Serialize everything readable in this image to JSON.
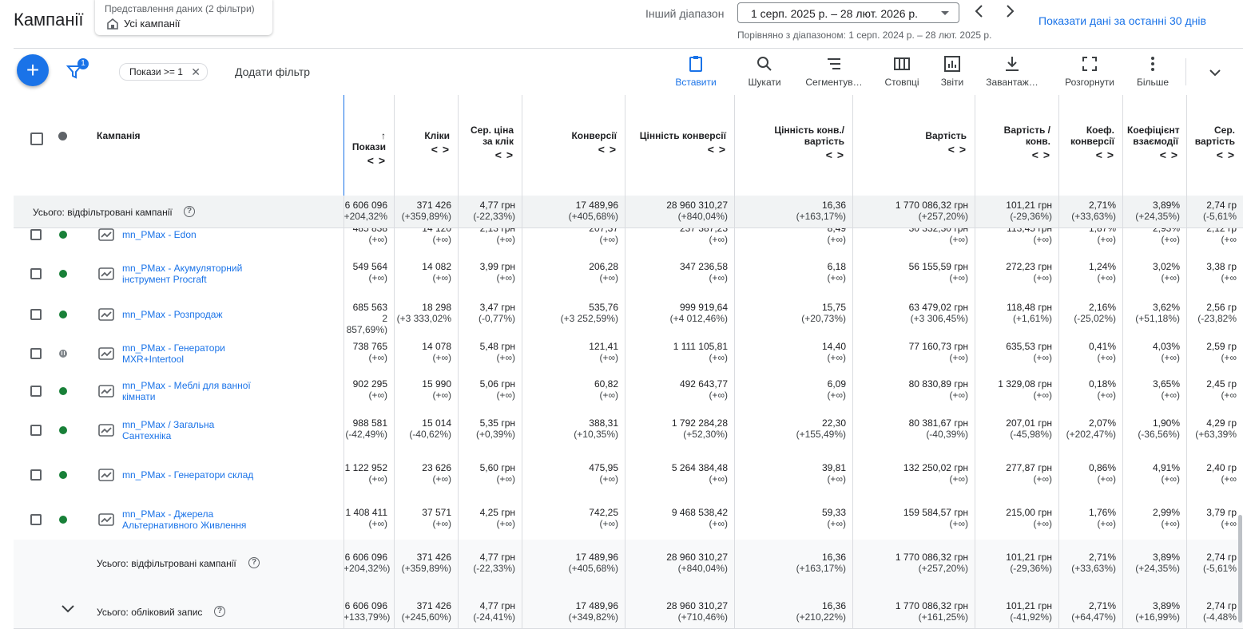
{
  "header": {
    "title": "Кампанії",
    "view_label": "Представлення даних (2 фільтри)",
    "view_value": "Усі кампанії",
    "range_label": "Інший діапазон",
    "range_value": "1 серп. 2025 р. – 28 лют. 2026 р.",
    "compare_text": "Порівняно з діапазоном: 1 серп. 2024 р. – 28 лют. 2025 р.",
    "last30_link": "Показати дані за останні 30 днів"
  },
  "toolbar": {
    "fab_label": "+",
    "filter_count": "1",
    "filter_chip": "Покази >= 1",
    "add_filter": "Додати фільтр",
    "buttons": [
      {
        "label": "Вставити",
        "icon": "clipboard-icon"
      },
      {
        "label": "Шукати",
        "icon": "search-icon"
      },
      {
        "label": "Сегментув…",
        "icon": "segment-icon"
      },
      {
        "label": "Стовпці",
        "icon": "columns-icon"
      },
      {
        "label": "Звіти",
        "icon": "reports-icon"
      },
      {
        "label": "Завантаж…",
        "icon": "download-icon"
      },
      {
        "label": "Розгорнути",
        "icon": "expand-icon"
      },
      {
        "label": "Більше",
        "icon": "more-vert-icon"
      }
    ]
  },
  "table": {
    "campaign_header": "Кампанія",
    "columns": [
      {
        "label": "Покази",
        "sorted": true
      },
      {
        "label": "Кліки"
      },
      {
        "label": "Сер. ціна за клік"
      },
      {
        "label": "Конверсії"
      },
      {
        "label": "Цінність конверсії"
      },
      {
        "label": "Цінність конв./ вартість"
      },
      {
        "label": "Вартість"
      },
      {
        "label": "Вартість / конв."
      },
      {
        "label": "Коеф. конверсії"
      },
      {
        "label": "Коефіцієнт взаємодії"
      },
      {
        "label": "Сер. вартість"
      }
    ],
    "sort_arrows": "<>",
    "top_total": {
      "label": "Усього: відфільтровані кампанії",
      "values": [
        [
          "6 606 096",
          "+204,32%"
        ],
        [
          "371 426",
          "(+359,89%)"
        ],
        [
          "4,77 грн",
          "(-22,33%)"
        ],
        [
          "17 489,96",
          "(+405,68%)"
        ],
        [
          "28 960 310,27",
          "(+840,04%)"
        ],
        [
          "16,36",
          "(+163,17%)"
        ],
        [
          "1 770 086,32 грн",
          "(+257,20%)"
        ],
        [
          "101,21 грн",
          "(-29,36%)"
        ],
        [
          "2,71%",
          "(+33,63%)"
        ],
        [
          "3,89%",
          "(+24,35%)"
        ],
        [
          "2,74 гр",
          "(-5,61%"
        ]
      ]
    },
    "rows": [
      {
        "name": "mn_PMax - Edon",
        "status": "active",
        "values": [
          [
            "485 838",
            "(+∞)"
          ],
          [
            "14 120",
            "(+∞)"
          ],
          [
            "2,13 грн",
            "(+∞)"
          ],
          [
            "207,37",
            "(+∞)"
          ],
          [
            "237 387,23",
            "(+∞)"
          ],
          [
            "8,49",
            "(+∞)"
          ],
          [
            "30 332,30 грн",
            "(+∞)"
          ],
          [
            "113,45 грн",
            "(+∞)"
          ],
          [
            "1,87%",
            "(+∞)"
          ],
          [
            "2,93%",
            "(+∞)"
          ],
          [
            "2,12 гр",
            "(+∞"
          ]
        ]
      },
      {
        "name": "mn_PMax - Акумуляторний інструмент Procraft",
        "status": "active",
        "values": [
          [
            "549 564",
            "(+∞)"
          ],
          [
            "14 082",
            "(+∞)"
          ],
          [
            "3,99 грн",
            "(+∞)"
          ],
          [
            "206,28",
            "(+∞)"
          ],
          [
            "347 236,58",
            "(+∞)"
          ],
          [
            "6,18",
            "(+∞)"
          ],
          [
            "56 155,59 грн",
            "(+∞)"
          ],
          [
            "272,23 грн",
            "(+∞)"
          ],
          [
            "1,24%",
            "(+∞)"
          ],
          [
            "3,02%",
            "(+∞)"
          ],
          [
            "3,38 гр",
            "(+∞"
          ]
        ]
      },
      {
        "name": "mn_PMax - Розпродаж",
        "status": "active",
        "values": [
          [
            "685 563",
            "2 857,69%)"
          ],
          [
            "18 298",
            "(+3 333,02%"
          ],
          [
            "3,47 грн",
            "(-0,77%)"
          ],
          [
            "535,76",
            "(+3 252,59%)"
          ],
          [
            "999 919,64",
            "(+4 012,46%)"
          ],
          [
            "15,75",
            "(+20,73%)"
          ],
          [
            "63 479,02 грн",
            "(+3 306,45%)"
          ],
          [
            "118,48 грн",
            "(+1,61%)"
          ],
          [
            "2,16%",
            "(-25,02%)"
          ],
          [
            "3,62%",
            "(+51,18%)"
          ],
          [
            "2,56 гр",
            "(-23,82%"
          ]
        ]
      },
      {
        "name": "mn_PMax - Генератори MXR+Intertool",
        "status": "paused",
        "values": [
          [
            "738 765",
            "(+∞)"
          ],
          [
            "14 078",
            "(+∞)"
          ],
          [
            "5,48 грн",
            "(+∞)"
          ],
          [
            "121,41",
            "(+∞)"
          ],
          [
            "1 111 105,81",
            "(+∞)"
          ],
          [
            "14,40",
            "(+∞)"
          ],
          [
            "77 160,73 грн",
            "(+∞)"
          ],
          [
            "635,53 грн",
            "(+∞)"
          ],
          [
            "0,41%",
            "(+∞)"
          ],
          [
            "4,03%",
            "(+∞)"
          ],
          [
            "2,59 гр",
            "(+∞"
          ]
        ]
      },
      {
        "name": "mn_PMax - Меблі для ванної кімнати",
        "status": "active",
        "values": [
          [
            "902 295",
            "(+∞)"
          ],
          [
            "15 990",
            "(+∞)"
          ],
          [
            "5,06 грн",
            "(+∞)"
          ],
          [
            "60,82",
            "(+∞)"
          ],
          [
            "492 643,77",
            "(+∞)"
          ],
          [
            "6,09",
            "(+∞)"
          ],
          [
            "80 830,89 грн",
            "(+∞)"
          ],
          [
            "1 329,08 грн",
            "(+∞)"
          ],
          [
            "0,18%",
            "(+∞)"
          ],
          [
            "3,65%",
            "(+∞)"
          ],
          [
            "2,45 гр",
            "(+∞"
          ]
        ]
      },
      {
        "name": "mn_PMax / Загальна Сантехніка",
        "status": "active",
        "values": [
          [
            "988 581",
            "(-42,49%)"
          ],
          [
            "15 014",
            "(-40,62%)"
          ],
          [
            "5,35 грн",
            "(+0,39%)"
          ],
          [
            "388,31",
            "(+10,35%)"
          ],
          [
            "1 792 284,28",
            "(+52,30%)"
          ],
          [
            "22,30",
            "(+155,49%)"
          ],
          [
            "80 381,67 грн",
            "(-40,39%)"
          ],
          [
            "207,01 грн",
            "(-45,98%)"
          ],
          [
            "2,07%",
            "(+202,47%)"
          ],
          [
            "1,90%",
            "(-36,56%)"
          ],
          [
            "4,29 гр",
            "(+63,39%"
          ]
        ]
      },
      {
        "name": "mn_PMax - Генератори склад",
        "status": "active",
        "values": [
          [
            "1 122 952",
            "(+∞)"
          ],
          [
            "23 626",
            "(+∞)"
          ],
          [
            "5,60 грн",
            "(+∞)"
          ],
          [
            "475,95",
            "(+∞)"
          ],
          [
            "5 264 384,48",
            "(+∞)"
          ],
          [
            "39,81",
            "(+∞)"
          ],
          [
            "132 250,02 грн",
            "(+∞)"
          ],
          [
            "277,87 грн",
            "(+∞)"
          ],
          [
            "0,86%",
            "(+∞)"
          ],
          [
            "4,91%",
            "(+∞)"
          ],
          [
            "2,40 гр",
            "(+∞"
          ]
        ]
      },
      {
        "name": "mn_PMax - Джерела Альтернативного Живлення",
        "status": "active",
        "values": [
          [
            "1 408 411",
            "(+∞)"
          ],
          [
            "37 571",
            "(+∞)"
          ],
          [
            "4,25 грн",
            "(+∞)"
          ],
          [
            "742,25",
            "(+∞)"
          ],
          [
            "9 468 538,42",
            "(+∞)"
          ],
          [
            "59,33",
            "(+∞)"
          ],
          [
            "159 584,57 грн",
            "(+∞)"
          ],
          [
            "215,00 грн",
            "(+∞)"
          ],
          [
            "1,76%",
            "(+∞)"
          ],
          [
            "2,99%",
            "(+∞)"
          ],
          [
            "3,79 гр",
            "(+∞"
          ]
        ]
      }
    ],
    "bottom_totals": [
      {
        "label": "Усього: відфільтровані кампанії",
        "values": [
          [
            "6 606 096",
            "+204,32%)"
          ],
          [
            "371 426",
            "(+359,89%)"
          ],
          [
            "4,77 грн",
            "(-22,33%)"
          ],
          [
            "17 489,96",
            "(+405,68%)"
          ],
          [
            "28 960 310,27",
            "(+840,04%)"
          ],
          [
            "16,36",
            "(+163,17%)"
          ],
          [
            "1 770 086,32 грн",
            "(+257,20%)"
          ],
          [
            "101,21 грн",
            "(-29,36%)"
          ],
          [
            "2,71%",
            "(+33,63%)"
          ],
          [
            "3,89%",
            "(+24,35%)"
          ],
          [
            "2,74 гр",
            "(-5,61%"
          ]
        ]
      },
      {
        "label": "Усього: обліковий запис",
        "values": [
          [
            "6 606 096",
            "+133,79%)"
          ],
          [
            "371 426",
            "(+245,60%)"
          ],
          [
            "4,77 грн",
            "(-24,41%)"
          ],
          [
            "17 489,96",
            "(+349,82%)"
          ],
          [
            "28 960 310,27",
            "(+710,46%)"
          ],
          [
            "16,36",
            "(+210,22%)"
          ],
          [
            "1 770 086,32 грн",
            "(+161,25%)"
          ],
          [
            "101,21 грн",
            "(-41,92%)"
          ],
          [
            "2,71%",
            "(+64,47%)"
          ],
          [
            "3,89%",
            "(+16,99%)"
          ],
          [
            "2,74 гр",
            "(-4,48%"
          ]
        ]
      }
    ]
  },
  "colors": {
    "accent": "#1a73e8",
    "active": "#188038",
    "paused": "#80868b"
  }
}
